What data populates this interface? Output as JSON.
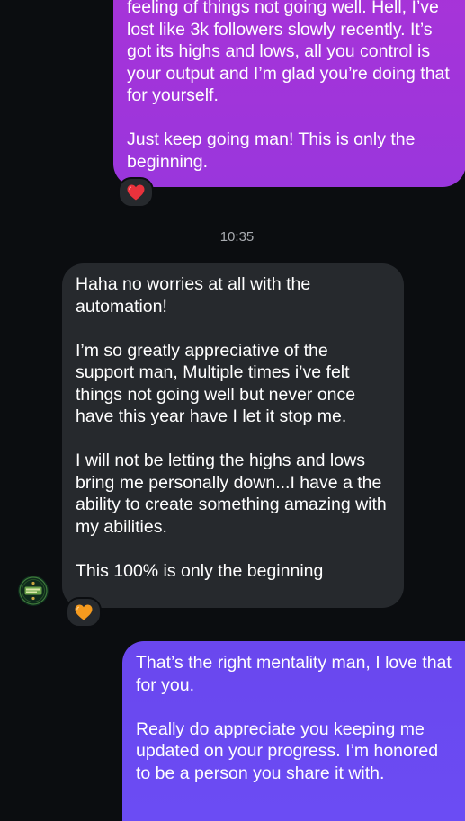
{
  "conversation": {
    "messages": [
      {
        "direction": "sent",
        "paragraphs": [
          "feeling of things not going well. Hell, I’ve lost like 3k followers slowly recently. It’s got its highs and lows, all you control is your output and I’m glad you’re doing that for yourself.",
          "Just keep going man! This is only the beginning."
        ],
        "reaction": "❤️"
      },
      {
        "direction": "received",
        "paragraphs": [
          "Haha no worries at all with the automation!",
          "I’m so greatly appreciative of the support man, Multiple times i’ve felt things not going well but never once have this year have I let it stop me.",
          "I will not be letting the highs and lows bring me personally down...I have a the ability to create something amazing with my abilities.",
          "This 100% is only the beginning"
        ],
        "reaction": "🧡"
      },
      {
        "direction": "sent",
        "paragraphs": [
          "That’s the right mentality man, I love that for you.",
          "Really do appreciate you keeping me updated on your progress. I’m honored to be a person you share it with."
        ]
      }
    ],
    "timestamp": "10:35"
  },
  "colors": {
    "background": "#0b0d10",
    "received_bubble": "#26292d",
    "sent_bubble_top": "#a833d8",
    "sent_bubble_bottom": "#6a47ee",
    "timestamp_text": "#a8abb0",
    "heart_red": "#e8323c",
    "heart_orange": "#f59a1e"
  },
  "icons": {
    "reaction_1": "red-heart-icon",
    "reaction_2": "orange-heart-icon",
    "avatar": "profile-avatar-logo"
  }
}
